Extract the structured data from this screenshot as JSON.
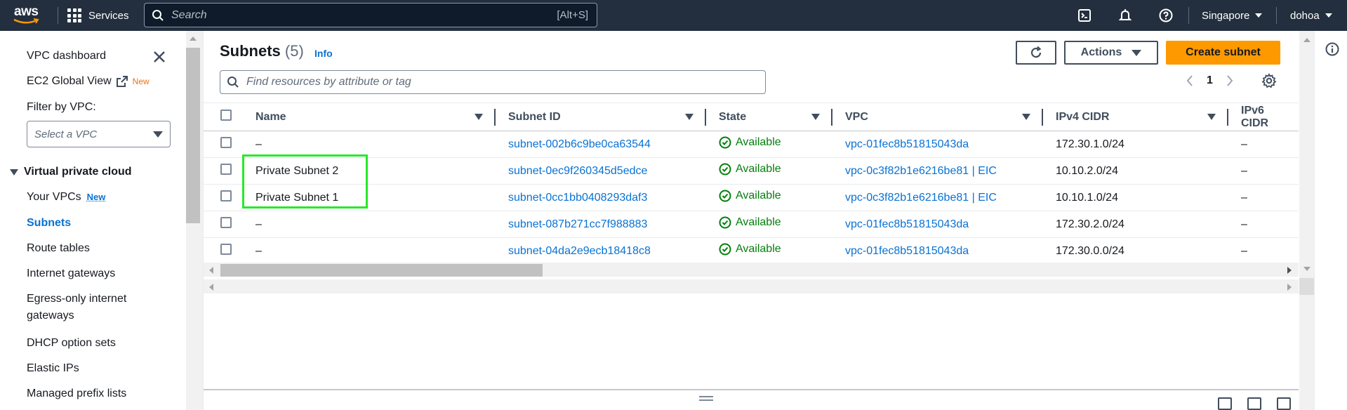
{
  "topbar": {
    "logo_text": "aws",
    "services_label": "Services",
    "search_placeholder": "Search",
    "search_shortcut": "[Alt+S]",
    "region_label": "Singapore",
    "account_label": "dohoa"
  },
  "sidebar": {
    "vpc_dashboard": "VPC dashboard",
    "ec2_global_view": "EC2 Global View",
    "ec2_global_view_badge": "New",
    "filter_label": "Filter by VPC:",
    "filter_placeholder": "Select a VPC",
    "section_title": "Virtual private cloud",
    "items": [
      {
        "label": "Your VPCs",
        "badge": "New"
      },
      {
        "label": "Subnets"
      },
      {
        "label": "Route tables"
      },
      {
        "label": "Internet gateways"
      },
      {
        "label": "Egress-only internet"
      },
      {
        "label": "gateways"
      },
      {
        "label": "DHCP option sets"
      },
      {
        "label": "Elastic IPs"
      },
      {
        "label": "Managed prefix lists"
      }
    ]
  },
  "main": {
    "title": "Subnets",
    "count": "(5)",
    "info": "Info",
    "actions_label": "Actions",
    "create_label": "Create subnet",
    "filter_placeholder": "Find resources by attribute or tag",
    "page_number": "1",
    "columns": [
      "Name",
      "Subnet ID",
      "State",
      "VPC",
      "IPv4 CIDR",
      "IPv6 CIDR"
    ],
    "rows": [
      {
        "name": "–",
        "subnet_id": "subnet-002b6c9be0ca63544",
        "state": "Available",
        "vpc": "vpc-01fec8b51815043da",
        "ipv4": "172.30.1.0/24",
        "ipv6": "–"
      },
      {
        "name": "Private Subnet 2",
        "subnet_id": "subnet-0ec9f260345d5edce",
        "state": "Available",
        "vpc": "vpc-0c3f82b1e6216be81 | EIC",
        "ipv4": "10.10.2.0/24",
        "ipv6": "–"
      },
      {
        "name": "Private Subnet 1",
        "subnet_id": "subnet-0cc1bb0408293daf3",
        "state": "Available",
        "vpc": "vpc-0c3f82b1e6216be81 | EIC",
        "ipv4": "10.10.1.0/24",
        "ipv6": "–"
      },
      {
        "name": "–",
        "subnet_id": "subnet-087b271cc7f988883",
        "state": "Available",
        "vpc": "vpc-01fec8b51815043da",
        "ipv4": "172.30.2.0/24",
        "ipv6": "–"
      },
      {
        "name": "–",
        "subnet_id": "subnet-04da2e9ecb18418c8",
        "state": "Available",
        "vpc": "vpc-01fec8b51815043da",
        "ipv4": "172.30.0.0/24",
        "ipv6": "–"
      }
    ]
  },
  "colors": {
    "nav_bg": "#232f3e",
    "link": "#0972d3",
    "success": "#037f0c",
    "primary_button": "#ff9900",
    "highlight_box": "#29e829"
  },
  "icons": [
    "grid-icon",
    "search-icon",
    "cloudshell-icon",
    "bell-icon",
    "help-icon",
    "close-icon",
    "external-link-icon",
    "refresh-icon",
    "settings-gear-icon",
    "check-circle-icon",
    "info-circle-icon"
  ]
}
